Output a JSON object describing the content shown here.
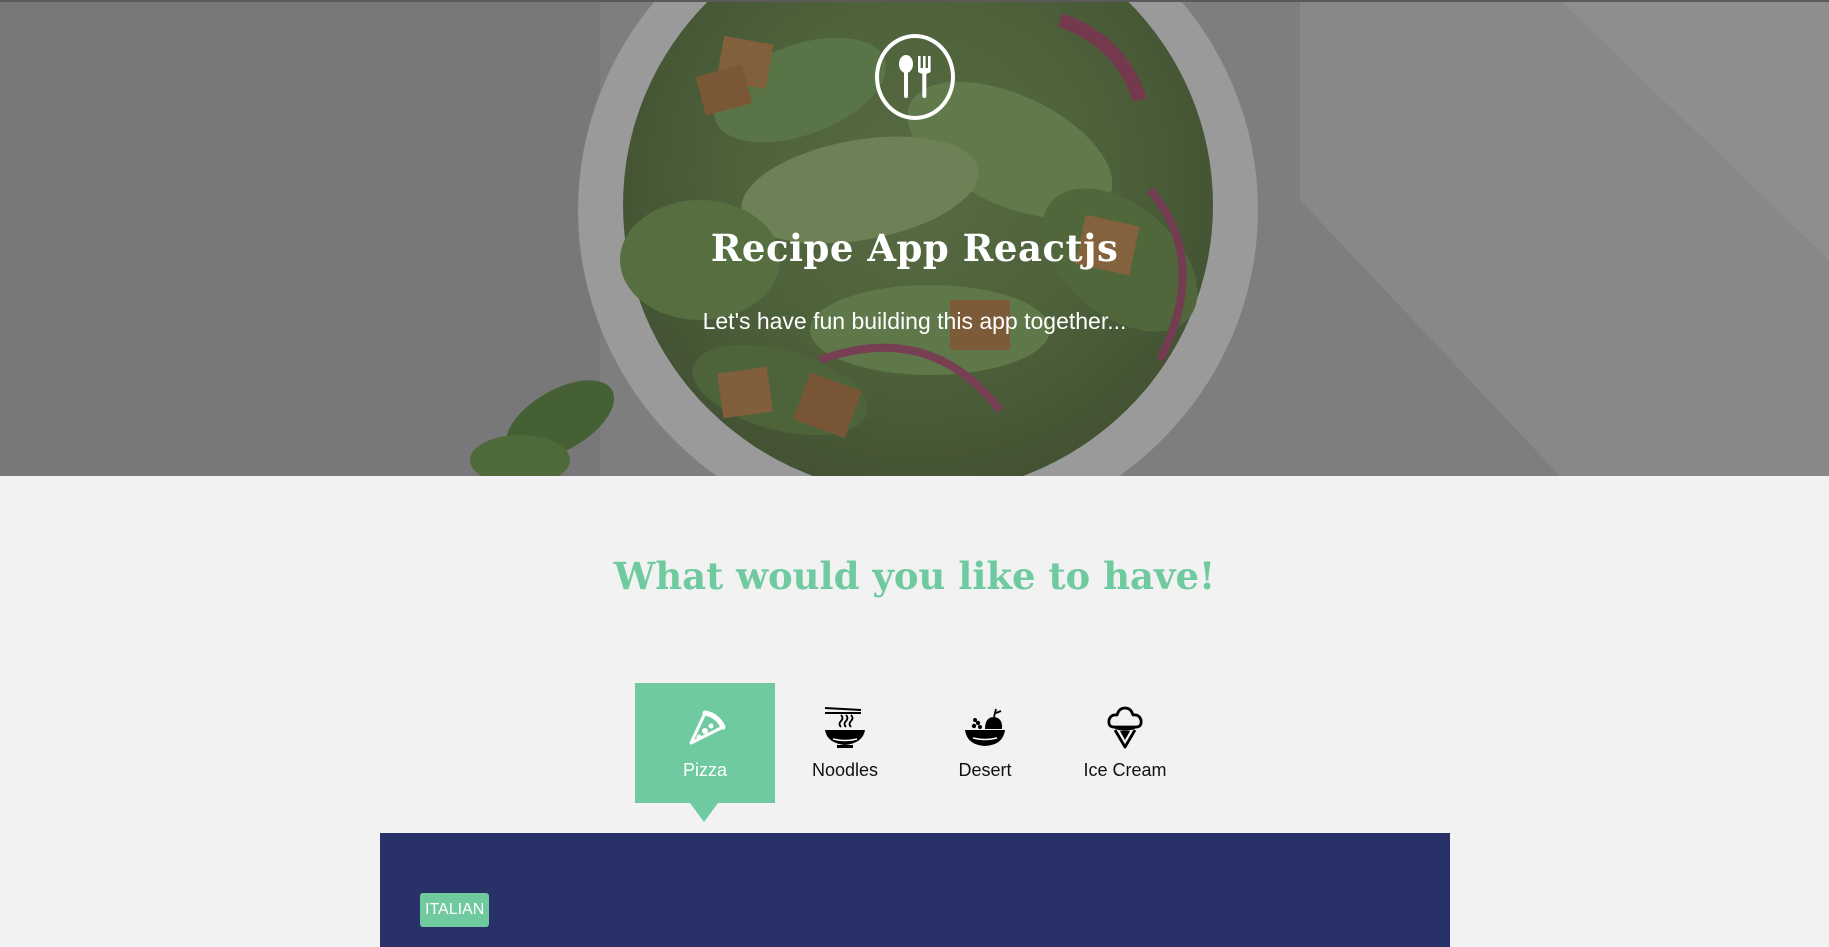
{
  "hero": {
    "logo_icon": "fork-spoon-icon",
    "title": "Recipe App Reactjs",
    "subtitle": "Let's have fun building this app together..."
  },
  "section": {
    "title": "What would you like to have!"
  },
  "tabs": [
    {
      "label": "Pizza",
      "icon": "pizza-icon",
      "active": true
    },
    {
      "label": "Noodles",
      "icon": "noodles-icon",
      "active": false
    },
    {
      "label": "Desert",
      "icon": "dessert-bowl-icon",
      "active": false
    },
    {
      "label": "Ice Cream",
      "icon": "ice-cream-icon",
      "active": false
    }
  ],
  "recipe_panel": {
    "cuisine_badge": "ITALIAN"
  },
  "colors": {
    "accent": "#6fcb9f",
    "panel": "#283268",
    "page_background": "#f2f2f2"
  }
}
